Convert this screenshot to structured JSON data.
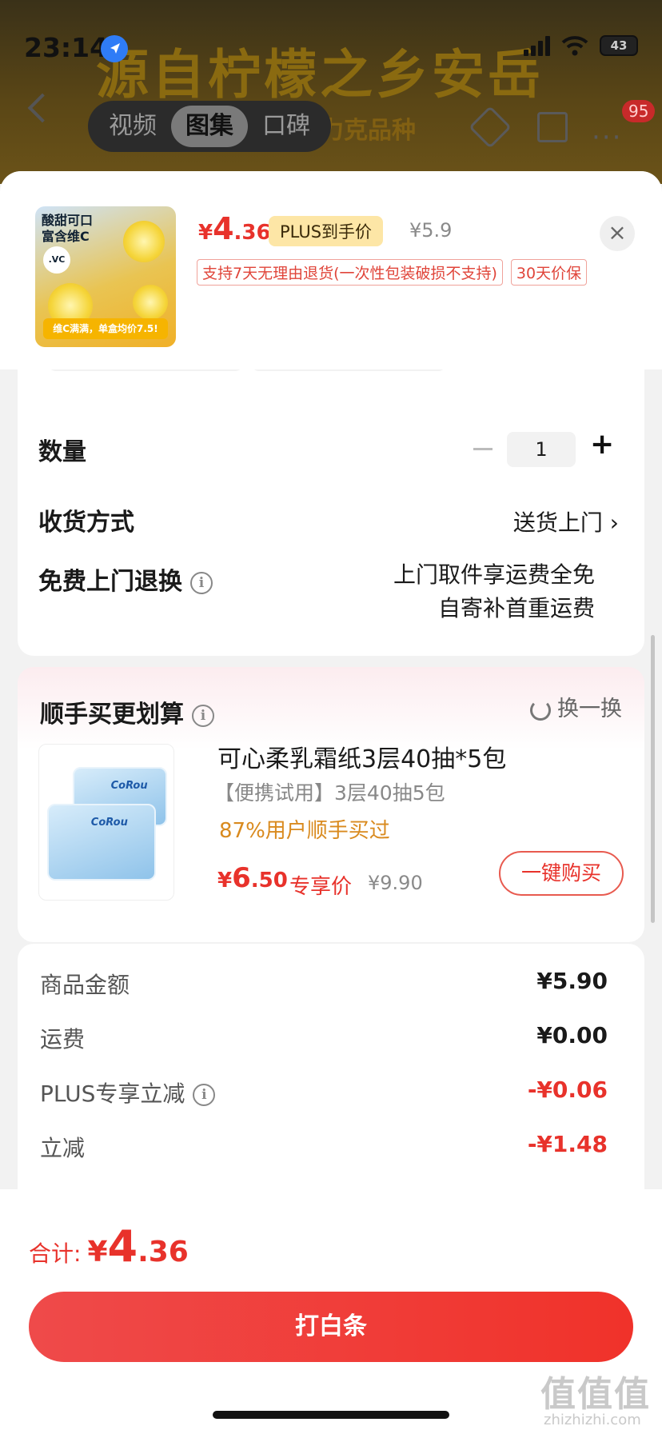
{
  "status_bar": {
    "time": "23:14",
    "battery": "43"
  },
  "background": {
    "banner": "源自柠檬之乡安岳",
    "sub_banner": "力克品种",
    "tabs": [
      {
        "label": "视频",
        "active": false
      },
      {
        "label": "图集",
        "active": true
      },
      {
        "label": "口碑",
        "active": false
      }
    ],
    "notification_count": "95"
  },
  "product": {
    "image_title_line1": "酸甜可口",
    "image_title_line2": "富含维C",
    "image_vc_badge": ".VC",
    "image_bar_text": "维C满满，单盒均价7.5!",
    "price_currency": "¥",
    "price_int": "4",
    "price_dec": ".36",
    "plus_tag": "PLUS到手价",
    "original_price": "¥5.9",
    "tags": [
      "支持7天无理由退货(一次性包装破损不支持)",
      "30天价保"
    ]
  },
  "options": {
    "quantity_label": "数量",
    "quantity_value": "1",
    "delivery_label": "收货方式",
    "delivery_value": "送货上门 ›",
    "free_return_label": "免费上门退换",
    "free_return_line1": "上门取件享运费全免",
    "free_return_line2": "自寄补首重运费"
  },
  "addon": {
    "section_title": "顺手买更划算",
    "refresh_label": "换一换",
    "item_title": "可心柔乳霜纸3层40抽*5包",
    "item_subtitle": "【便携试用】3层40抽5包",
    "item_buyers": "87%用户顺手买过",
    "item_price_currency": "¥",
    "item_price_int": "6",
    "item_price_dec": ".50",
    "item_price_tag": "专享价",
    "item_original_price": "¥9.90",
    "item_brand_logo": "CoRou",
    "buy_button": "一键购买"
  },
  "summary": {
    "rows": [
      {
        "label": "商品金额",
        "value": "¥5.90",
        "highlight": false
      },
      {
        "label": "运费",
        "value": "¥0.00",
        "highlight": false
      },
      {
        "label": "PLUS专享立减",
        "value": "-¥0.06",
        "highlight": true
      },
      {
        "label": "立减",
        "value": "-¥1.48",
        "highlight": true
      }
    ]
  },
  "footer": {
    "total_label": "合计:",
    "total_currency": "¥",
    "total_int": "4",
    "total_dec": ".36",
    "pay_button": "打白条"
  },
  "watermark": {
    "logo_text": "值值值",
    "site": "zhizhizhi.com"
  },
  "colors": {
    "accent_red": "#e8322b",
    "plus_gold": "#fde6a6",
    "buyers_orange": "#d98a1e"
  }
}
